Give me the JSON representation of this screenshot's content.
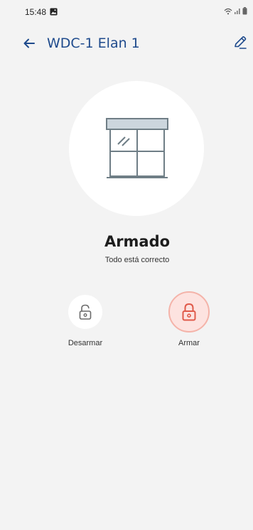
{
  "status_bar": {
    "time": "15:48"
  },
  "app_bar": {
    "title": "WDC-1 Elan 1"
  },
  "device": {
    "icon": "window-icon",
    "state_title": "Armado",
    "state_subtitle": "Todo está correcto"
  },
  "actions": {
    "disarm_label": "Desarmar",
    "arm_label": "Armar",
    "active": "arm"
  },
  "colors": {
    "title": "#1e4a8c",
    "arm_accent": "#e05a4a",
    "arm_bg": "#fde3e0",
    "background": "#f3f3f3"
  }
}
